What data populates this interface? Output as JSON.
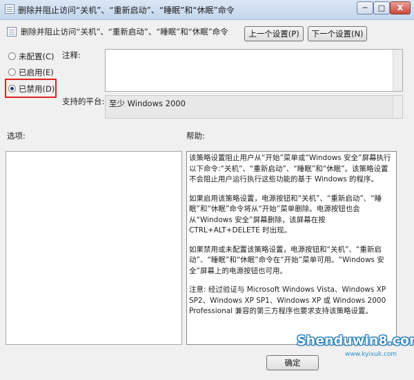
{
  "window": {
    "title": "删除并阻止访问“关机”、“重新启动”、“睡眠”和“休眠”命令",
    "controls": {
      "minimize": "─",
      "maximize": "□",
      "close": "X"
    }
  },
  "header": {
    "policy_name": "删除并阻止访问“关机”、“重新启动”、“睡眠”和“休眠”命令",
    "prev_button": "上一个设置(P)",
    "next_button": "下一个设置(N)"
  },
  "options": {
    "not_configured": "未配置(C)",
    "enabled": "已启用(E)",
    "disabled": "已禁用(D)",
    "selected": "disabled"
  },
  "comment": {
    "label": "注释:",
    "value": ""
  },
  "platform": {
    "label": "支持的平台:",
    "value": "至少 Windows 2000"
  },
  "options_section": {
    "label": "选项:"
  },
  "help_section": {
    "label": "帮助:",
    "paragraphs": [
      "该策略设置阻止用户从“开始”菜单或“Windows 安全”屏幕执行以下命令:“关机”、“重新启动”、“睡眠”和“休眠”。该策略设置不会阻止用户运行执行这些功能的基于 Windows 的程序。",
      "如果启用该策略设置，电源按钮和“关机”、“重新启动”、“睡眠”和“休眠”命令将从“开始”菜单删除。电源按钮也会从“Windows 安全”屏幕删除，该屏幕在按 CTRL+ALT+DELETE 时出现。",
      "如果禁用或未配置该策略设置，电源按钮和“关机”、“重新启动”、“睡眠”和“休眠”命令在“开始”菜单可用。“Windows 安全”屏幕上的电源按钮也可用。",
      "注意: 经过验证与 Microsoft Windows Vista、Windows XP SP2、Windows XP SP1、Windows XP 或 Windows 2000 Professional 兼容的第三方程序也要求支持该策略设置。"
    ]
  },
  "footer": {
    "ok_button": "确定"
  },
  "watermark": {
    "main": "Shenduwin8.com",
    "sub": "www.kyixuk.com"
  }
}
